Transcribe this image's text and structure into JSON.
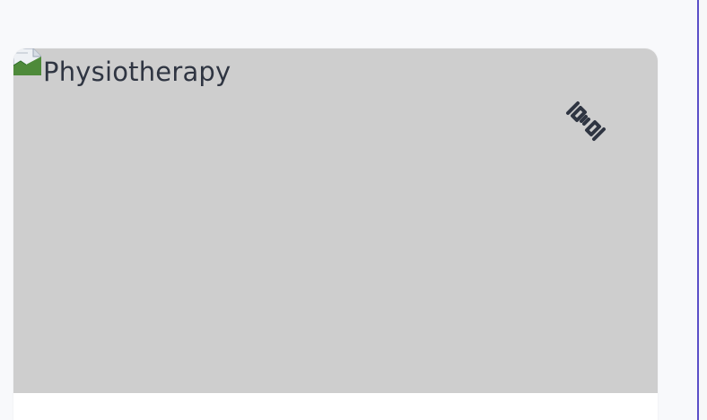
{
  "card": {
    "image_alt": "Physiotherapy",
    "category_icon": "dumbbell-icon"
  },
  "colors": {
    "page_bg": "#f8f9fb",
    "image_bg": "#cecece",
    "icon_color": "#2f3542",
    "accent_edge": "#5b4fc8"
  }
}
